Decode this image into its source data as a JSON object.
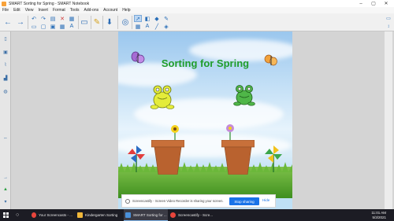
{
  "window": {
    "title": "SMART Sorting for Spring - SMART Notebook",
    "controls": [
      "–",
      "▢",
      "✕"
    ]
  },
  "menu": [
    "File",
    "Edit",
    "View",
    "Insert",
    "Format",
    "Tools",
    "Add-ons",
    "Account",
    "Help"
  ],
  "page": {
    "title": "Sorting for Spring",
    "title_color": "#1f9d2a"
  },
  "share_bar": {
    "message": "Screencastify - Screen Video Recorder is sharing your screen.",
    "stop_label": "Stop sharing",
    "hide_label": "Hide"
  },
  "taskbar": {
    "apps": [
      {
        "label": "Your Screencasts - ...",
        "color": "#e8453c"
      },
      {
        "label": "Kindergarten Sorting",
        "color": "#f0b73a"
      },
      {
        "label": "SMART Sorting for ...",
        "color": "#4a90d9"
      },
      {
        "label": "Screencastify - Scre...",
        "color": "#e8453c"
      }
    ],
    "time": "11:01 AM",
    "date": "5/3/2021"
  },
  "colors": {
    "toolbar_icon": "#2a6fb8",
    "share_button": "#1a73e8"
  }
}
